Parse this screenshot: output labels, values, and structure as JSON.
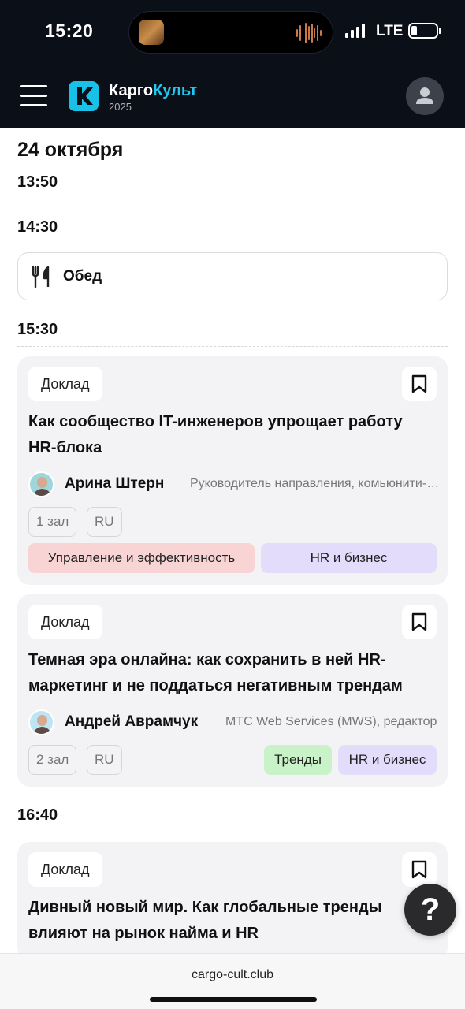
{
  "status_bar": {
    "time": "15:20",
    "network": "LTE",
    "icons": [
      "signal-icon",
      "battery-icon"
    ]
  },
  "header": {
    "brand_part1": "Карго",
    "brand_part2": "Культ",
    "brand_year": "2025",
    "brand_accent_color": "#1fc8ee",
    "icons": [
      "menu-icon",
      "logo-icon",
      "profile-icon"
    ]
  },
  "schedule": {
    "date": "24 октября",
    "times": [
      "13:50",
      "14:30",
      "15:30",
      "16:40"
    ],
    "lunch_label": "Обед",
    "lunch_icon": "fork-knife-icon"
  },
  "talks": [
    {
      "kind": "Доклад",
      "title_line1": "Как сообщество IT-инженеров упрощает работу",
      "title_line2": "HR-блока",
      "speaker": "Арина Штерн",
      "role": "Руководитель направления, комьюнити-менеджмент",
      "hall": "1 зал",
      "lang": "RU",
      "tags": [
        "Управление и эффективность",
        "HR и бизнес"
      ]
    },
    {
      "kind": "Доклад",
      "title_line1": "Темная эра онлайна: как сохранить в ней HR-",
      "title_line2": "маркетинг и не поддаться негативным трендам",
      "speaker": "Андрей Аврамчук",
      "role": "МТС Web Services (MWS), редактор",
      "hall": "2 зал",
      "lang": "RU",
      "tags": [
        "Тренды",
        "HR и бизнес"
      ]
    },
    {
      "kind": "Доклад",
      "title_line1": "Дивный новый мир. Как глобальные тренды",
      "title_line2": "влияют на рынок найма и HR"
    }
  ],
  "help_label": "?",
  "browser": {
    "url": "cargo-cult.club"
  },
  "colors": {
    "header_bg": "#0b0f17",
    "tag_management": "#f9d4d4",
    "tag_hr": "#e4dcfb",
    "tag_trends": "#c9f2c9"
  }
}
